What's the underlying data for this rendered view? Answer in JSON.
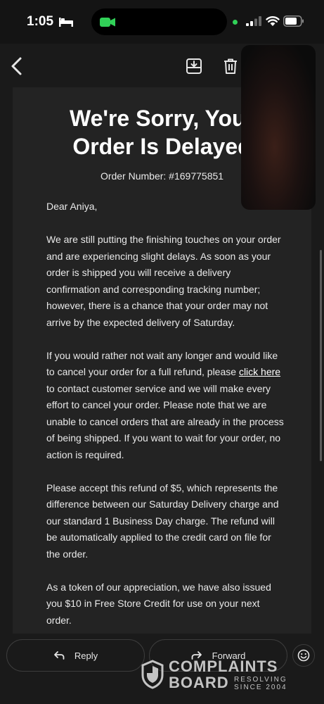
{
  "status_bar": {
    "time": "1:05",
    "icons": [
      "bed-icon",
      "camera-icon",
      "signal-icon",
      "wifi-icon",
      "battery-icon"
    ],
    "camera_color": "#31d158"
  },
  "toolbar": {
    "icons": [
      "back-icon",
      "archive-icon",
      "trash-icon"
    ]
  },
  "email": {
    "title": "We're Sorry, Your\nOrder Is Delayed",
    "order_number": "Order Number: #169775851",
    "greeting": "Dear Aniya,",
    "p1": "We are still putting the finishing touches on your order and are experiencing slight delays. As soon as your order is shipped you will receive a delivery confirmation and corresponding tracking number; however, there is a chance that your order may not arrive by the expected delivery of Saturday.",
    "p2_before": "If you would rather not wait any longer and would like to cancel your order for a full refund, please ",
    "p2_link": "click here",
    "p2_after": " to contact customer service and we will make every effort to cancel your order. Please note that we are unable to cancel orders that are already in the process of being shipped. If you want to wait for your order, no action is required.",
    "p3": "Please accept this refund of $5, which represents the difference between our Saturday Delivery charge and our standard 1 Business Day charge. The refund will be automatically applied to the credit card on file for the order.",
    "p4": "As a token of our appreciation, we have also issued you $10 in Free Store Credit for use on your next order."
  },
  "actions": {
    "reply_label": "Reply",
    "forward_label": "Forward",
    "icons": [
      "reply-icon",
      "forward-icon",
      "emoji-icon"
    ]
  },
  "watermark": {
    "line1": "COMPLAINTS",
    "line2": "BOARD",
    "tag1": "RESOLVING",
    "tag2": "SINCE 2004"
  }
}
